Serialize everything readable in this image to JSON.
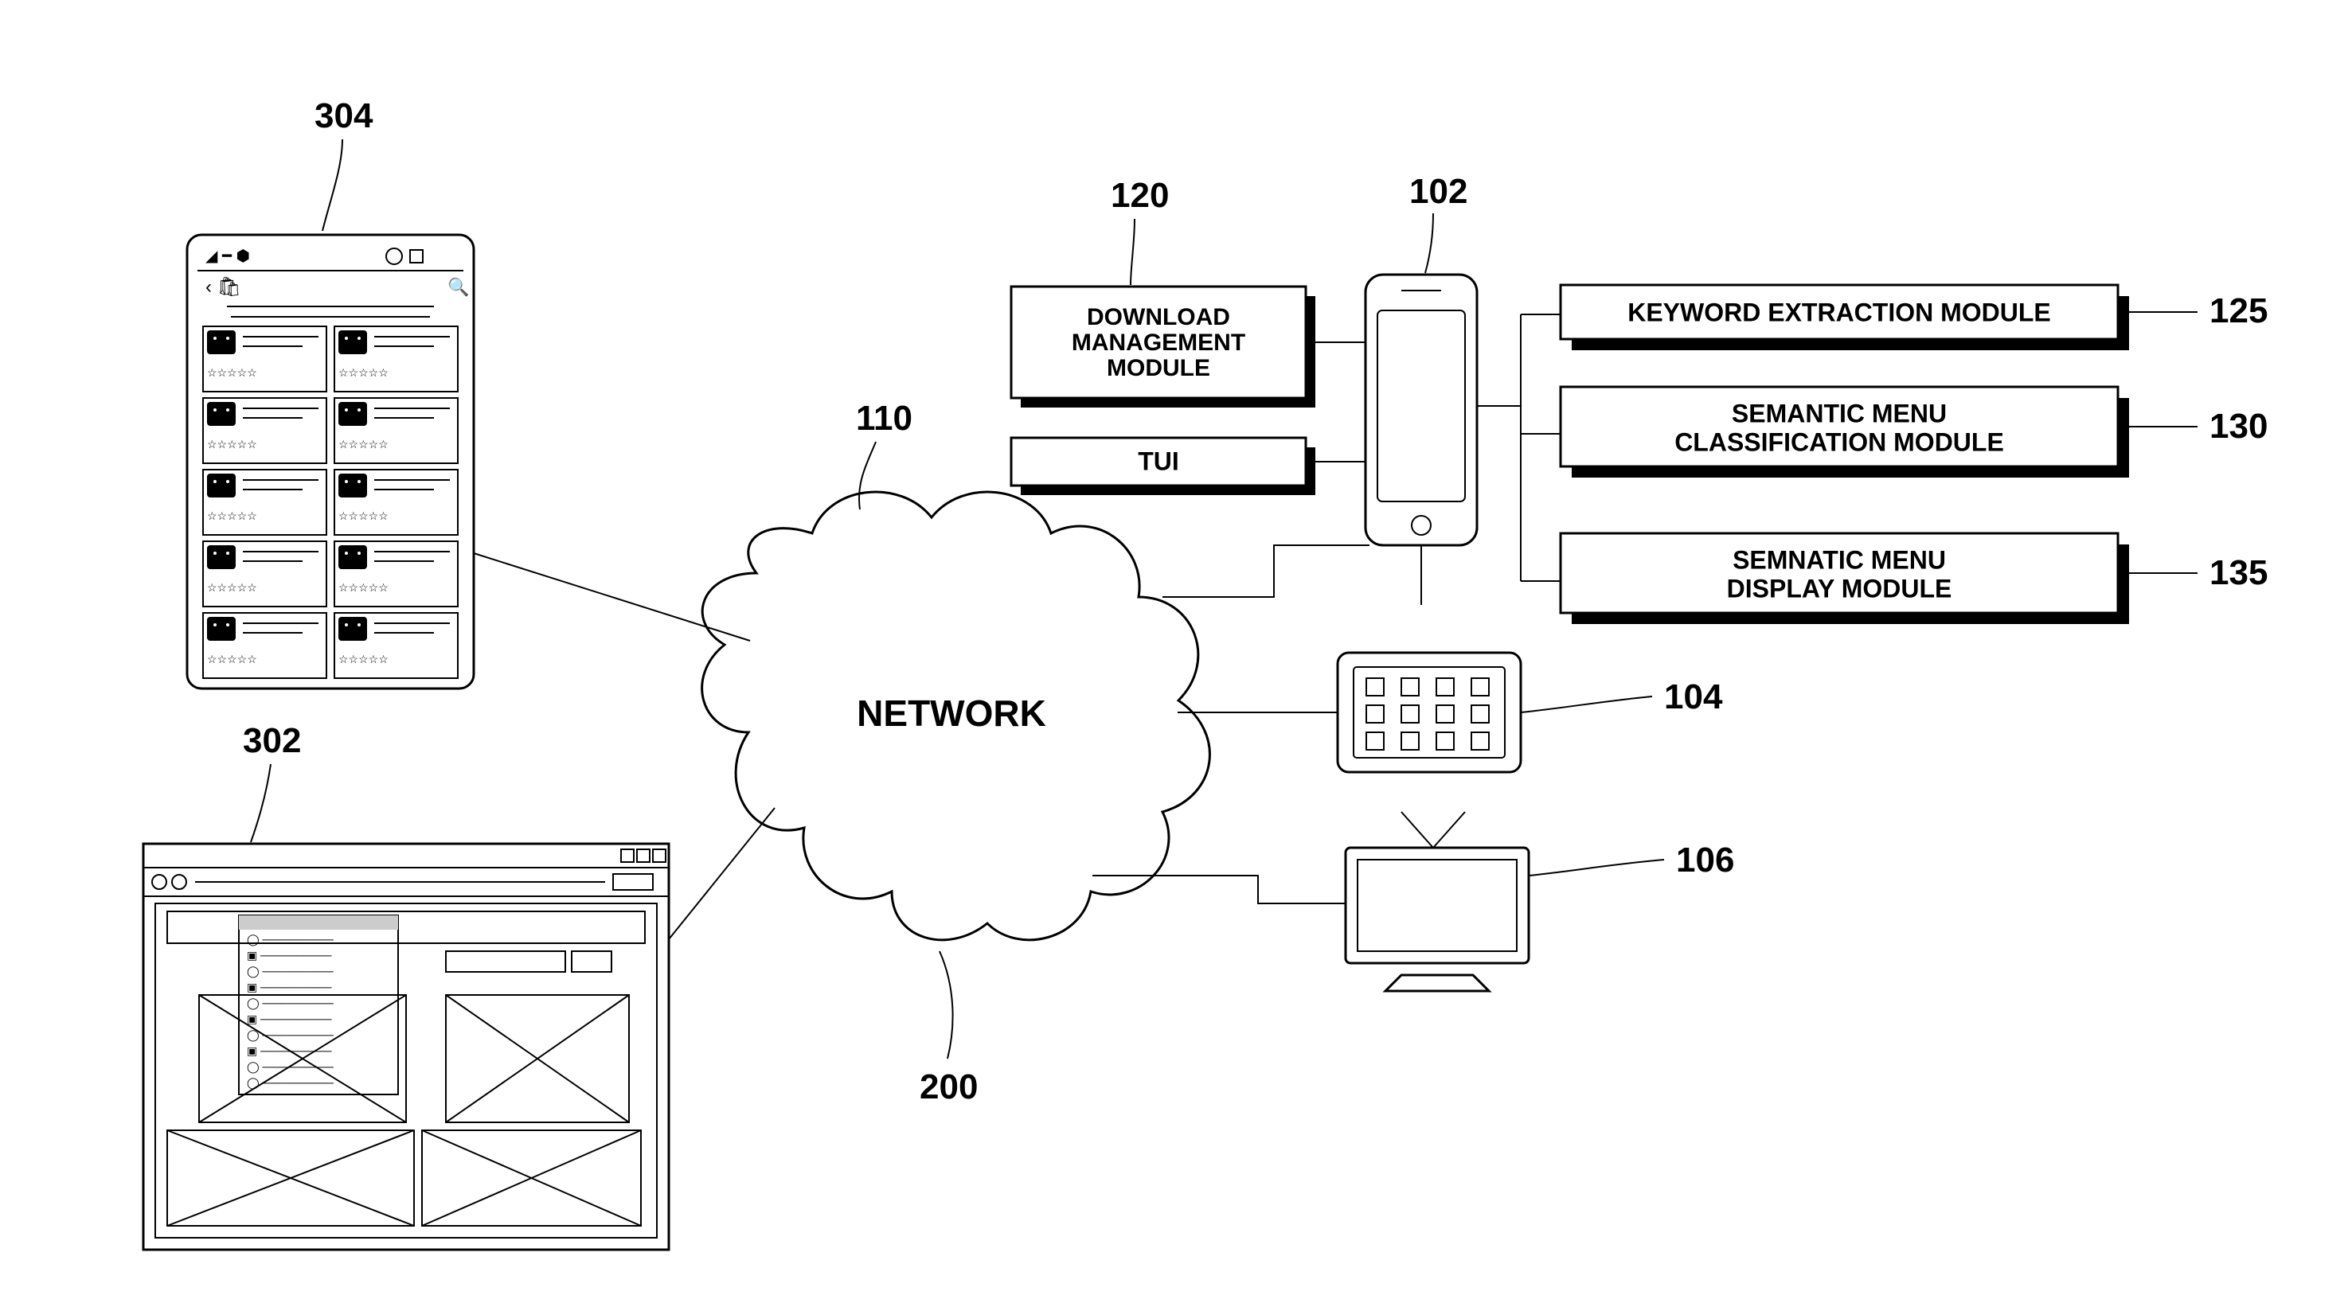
{
  "labels": {
    "network": "NETWORK",
    "download": {
      "l1": "DOWNLOAD",
      "l2": "MANAGEMENT",
      "l3": "MODULE"
    },
    "tui": "TUI",
    "keyword": "KEYWORD  EXTRACTION  MODULE",
    "classification": {
      "l1": "SEMANTIC  MENU",
      "l2": "CLASSIFICATION  MODULE"
    },
    "display": {
      "l1": "SEMNATIC  MENU",
      "l2": "DISPLAY  MODULE"
    }
  },
  "refs": {
    "r304": "304",
    "r302": "302",
    "r110": "110",
    "r200": "200",
    "r120": "120",
    "r102": "102",
    "r104": "104",
    "r106": "106",
    "r125": "125",
    "r130": "130",
    "r135": "135"
  }
}
